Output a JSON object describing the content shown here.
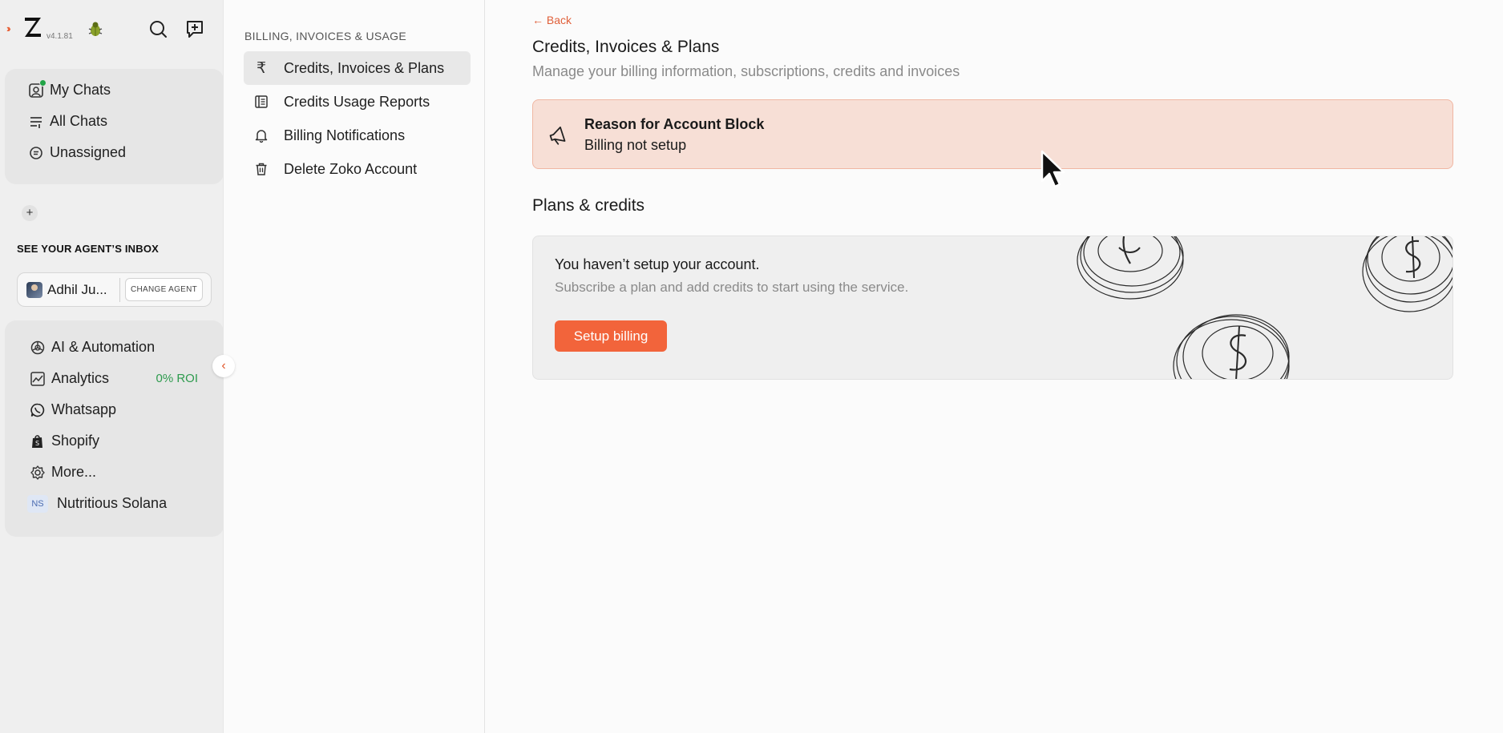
{
  "app": {
    "version": "v4.1.81"
  },
  "sidebar": {
    "nav": [
      {
        "label": "My Chats",
        "icon": "my-chats-icon"
      },
      {
        "label": "All Chats",
        "icon": "all-chats-icon"
      },
      {
        "label": "Unassigned",
        "icon": "unassigned-icon"
      }
    ],
    "agent_section_title": "SEE YOUR AGENT’S INBOX",
    "agent_name": "Adhil Ju...",
    "change_agent_label": "CHANGE AGENT",
    "apps": [
      {
        "label": "AI & Automation",
        "icon": "ai-automation-icon"
      },
      {
        "label": "Analytics",
        "icon": "analytics-icon",
        "badge": "0% ROI"
      },
      {
        "label": "Whatsapp",
        "icon": "whatsapp-icon"
      },
      {
        "label": "Shopify",
        "icon": "shopify-icon"
      },
      {
        "label": "More...",
        "icon": "more-icon"
      }
    ],
    "workspace": {
      "initials": "NS",
      "name": "Nutritious Solana"
    }
  },
  "settings_nav": {
    "heading": "BILLING, INVOICES & USAGE",
    "items": [
      {
        "label": "Credits, Invoices & Plans",
        "icon": "rupee-icon",
        "active": true
      },
      {
        "label": "Credits Usage Reports",
        "icon": "report-icon"
      },
      {
        "label": "Billing Notifications",
        "icon": "bell-icon"
      },
      {
        "label": "Delete Zoko Account",
        "icon": "trash-icon"
      }
    ]
  },
  "main": {
    "back_label": "← Back",
    "title": "Credits, Invoices & Plans",
    "subtitle": "Manage your billing information, subscriptions, credits and invoices",
    "alert": {
      "title": "Reason for Account Block",
      "text": "Billing not setup"
    },
    "plans_title": "Plans & credits",
    "plan_card": {
      "title": "You haven’t setup your account.",
      "subtitle": "Subscribe a plan and add credits to start using the service.",
      "button_label": "Setup billing"
    }
  },
  "colors": {
    "accent": "#f2643b",
    "alert_bg": "#f7dfd6",
    "online": "#22a447",
    "roi": "#2e9b4e"
  }
}
